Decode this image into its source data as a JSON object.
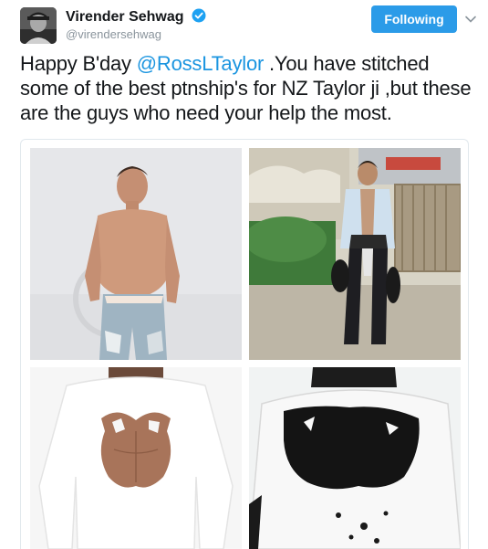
{
  "user": {
    "display_name": "Virender Sehwag",
    "handle": "@virendersehwag",
    "avatar_icon": "avatar-photo",
    "verified_icon": "verified-badge-icon"
  },
  "actions": {
    "follow_label": "Following",
    "menu_icon": "chevron-down-icon"
  },
  "tweet": {
    "text_before": "Happy B'day ",
    "mention": "@RossLTaylor",
    "text_after": " .You have stitched some of the best ptnship's for NZ Taylor ji ,but these are the guys who need your help the most."
  },
  "colors": {
    "follow_button": "#2b9be8",
    "mention": "#1b95e0",
    "verified": "#1da1f2"
  }
}
